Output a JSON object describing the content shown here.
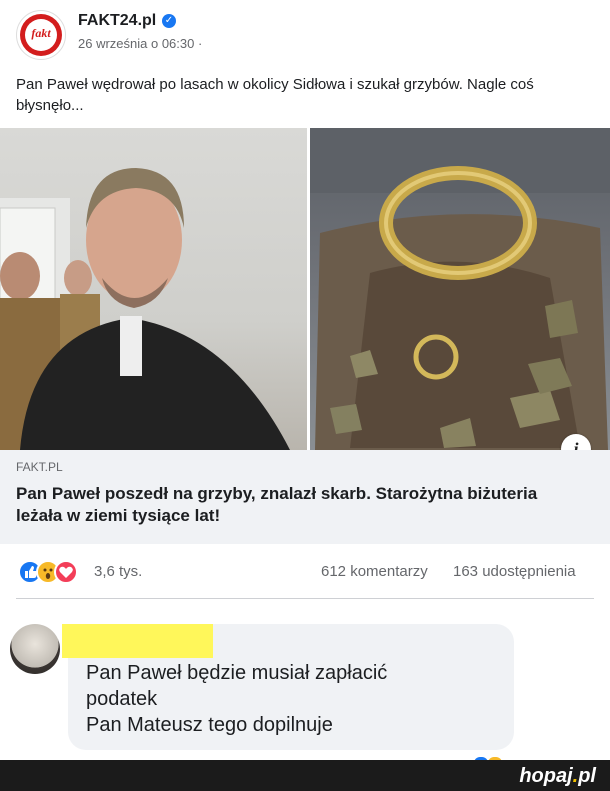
{
  "post": {
    "page_name": "FAKT24.pl",
    "avatar_text": "fakt",
    "timestamp": "26 września o 06:30 ·",
    "text": "Pan Paweł wędrował po lasach w okolicy Sidłowa i szukał grzybów. Nagle coś błysnęło...",
    "link": {
      "domain": "FAKT.PL",
      "title": "Pan Paweł poszedł na grzyby, znalazł skarb. Starożytna biżuteria leżała w ziemi tysiące lat!"
    },
    "info_label": "i",
    "reactions": {
      "icons": [
        "like-icon",
        "wow-icon",
        "love-icon"
      ],
      "colors": {
        "like": "#1877f2",
        "wow": "#f7b928",
        "love": "#f33e58"
      },
      "count": "3,6 tys.",
      "comments": "612 komentarzy",
      "shares": "163 udostępnienia"
    }
  },
  "comment": {
    "text_line1": "Pan Paweł będzie musiał zapłacić",
    "text_line2": "podatek",
    "text_line3": "Pan Mateusz tego dopilnuje"
  },
  "footer": {
    "logo_main": "hopaj",
    "logo_dot": ".",
    "logo_tld": "pl"
  }
}
